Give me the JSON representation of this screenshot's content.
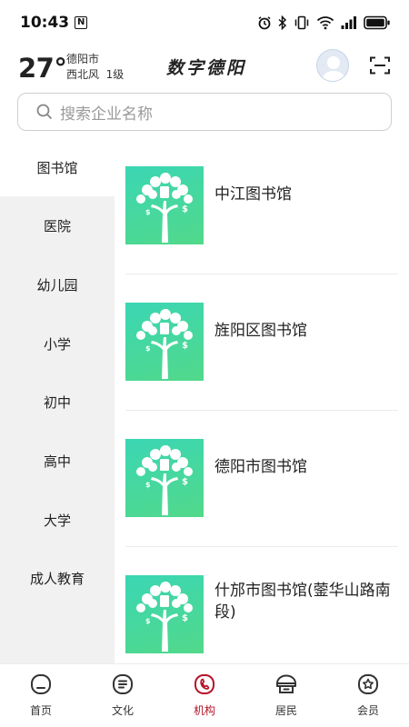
{
  "status_bar": {
    "time": "10:43",
    "n_badge": "N",
    "icons": [
      "alarm-icon",
      "bluetooth-icon",
      "vibrate-icon",
      "wifi-icon",
      "signal-icon",
      "battery-icon"
    ]
  },
  "header": {
    "temperature": "27°",
    "city": "德阳市",
    "wind": "西北风  1级",
    "brand": "数字德阳",
    "avatar_icon": "avatar-icon",
    "scan_icon": "scan-icon"
  },
  "search": {
    "placeholder": "搜索企业名称",
    "icon": "search-icon"
  },
  "sidebar": {
    "items": [
      {
        "label": "图书馆",
        "active": true
      },
      {
        "label": "医院"
      },
      {
        "label": "幼儿园"
      },
      {
        "label": "小学"
      },
      {
        "label": "初中"
      },
      {
        "label": "高中"
      },
      {
        "label": "大学"
      },
      {
        "label": "成人教育"
      }
    ]
  },
  "list": {
    "items": [
      {
        "name": "中江图书馆",
        "thumb_icon": "money-tree-icon"
      },
      {
        "name": "旌阳区图书馆",
        "thumb_icon": "money-tree-icon"
      },
      {
        "name": "德阳市图书馆",
        "thumb_icon": "money-tree-icon"
      },
      {
        "name": "什邡市图书馆(蓥华山路南段)",
        "thumb_icon": "money-tree-icon"
      }
    ]
  },
  "tabbar": {
    "accent_color": "#b3142a",
    "items": [
      {
        "label": "首页",
        "icon": "home-icon"
      },
      {
        "label": "文化",
        "icon": "culture-icon"
      },
      {
        "label": "机构",
        "icon": "institution-icon",
        "active": true
      },
      {
        "label": "居民",
        "icon": "resident-icon"
      },
      {
        "label": "会员",
        "icon": "member-icon"
      }
    ]
  }
}
